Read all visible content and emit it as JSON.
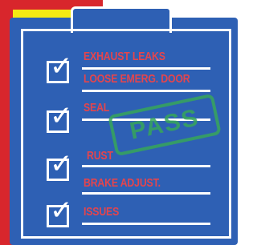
{
  "checklist": {
    "items": [
      {
        "label": "EXHAUST LEAKS"
      },
      {
        "label": "LOOSE EMERG. DOOR"
      },
      {
        "label": "SEAL"
      },
      {
        "label": "RUST"
      },
      {
        "label": "BRAKE ADJUST."
      },
      {
        "label": "ISSUES"
      }
    ],
    "check_icon": "checkmark-icon"
  },
  "stamp": {
    "text": "PASS"
  },
  "colors": {
    "clipboard": "#2e60b4",
    "label_text": "#e4454d",
    "stamp": "#37a65a",
    "yellow": "#f5ea12",
    "red": "#d8262c"
  }
}
